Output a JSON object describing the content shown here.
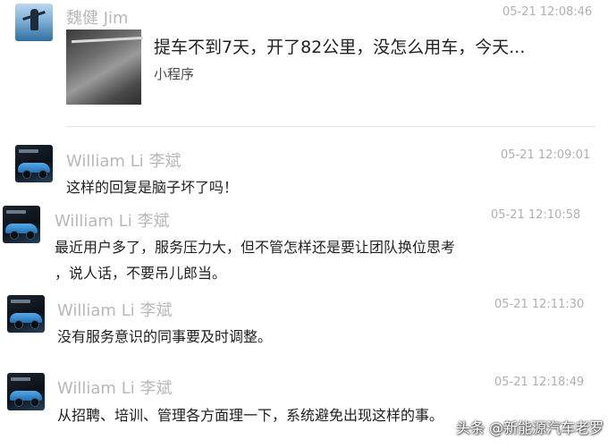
{
  "messages": [
    {
      "sender": "魏健 Jim",
      "time": "05-21 12:08:46",
      "card": {
        "title": "提车不到7天，开了82公里，没怎么用车，今天...",
        "tag": "小程序"
      }
    },
    {
      "sender": "William Li 李斌",
      "time": "05-21 12:09:01",
      "lines": [
        "这样的回复是脑子坏了吗！"
      ]
    },
    {
      "sender": "William Li 李斌",
      "time": "05-21 12:10:58",
      "lines": [
        "最近用户多了，服务压力大，但不管怎样还是要让团队换位思考",
        "，说人话，不要吊儿郎当。"
      ]
    },
    {
      "sender": "William Li 李斌",
      "time": "05-21 12:11:30",
      "lines": [
        "没有服务意识的同事要及时调整。"
      ]
    },
    {
      "sender": "William Li 李斌",
      "time": "05-21 12:18:49",
      "lines": [
        "从招聘、培训、管理各方面理一下，系统避免出现这样的事。"
      ]
    }
  ],
  "watermark": "头条 @新能源汽车老罗"
}
